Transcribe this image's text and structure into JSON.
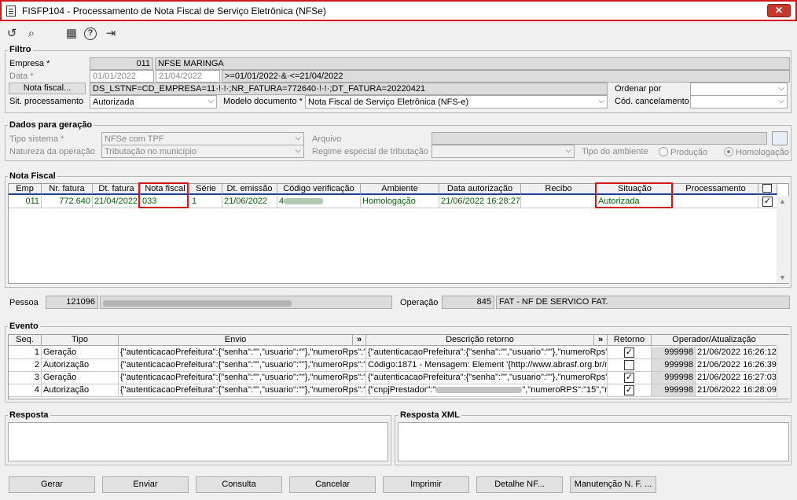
{
  "window": {
    "title": "FISFP104 - Processamento de Nota Fiscal de Serviço Eletrônica (NFSe)",
    "close": "✕"
  },
  "toolbar": {
    "undo": "↺",
    "search": "⌕",
    "calendar": "▦",
    "help": "?",
    "exit": "⇥"
  },
  "filtro": {
    "group": "Filtro",
    "empresa_label": "Empresa *",
    "empresa_code": "011",
    "empresa_name": "NFSE MARINGA",
    "data_label": "Data *",
    "data_from": "01/01/2022",
    "data_to": "21/04/2022",
    "data_expr": ">=01/01/2022·&·<=21/04/2022",
    "nota_btn": "Nota fiscal...",
    "nota_expr": "DS_LSTNF=CD_EMPRESA=11·!·!·;NR_FATURA=772640·!·!·;DT_FATURA=20220421",
    "ordenar_label": "Ordenar por",
    "ordenar_value": "",
    "sit_label": "Sit. processamento",
    "sit_value": "Autorizada",
    "modelo_label": "Modelo documento *",
    "modelo_value": "Nota Fiscal de Serviço Eletrônica (NFS-e)",
    "cod_label": "Cód. cancelamento",
    "cod_value": ""
  },
  "dados": {
    "group": "Dados para geração",
    "tipo_label": "Tipo sistema *",
    "tipo_value": "NFSe com TPF",
    "natureza_label": "Natureza da operação",
    "natureza_value": "Tributação no município",
    "arquivo_label": "Arquivo",
    "arquivo_value": "",
    "regime_label": "Regime especial de tributação",
    "regime_value": "",
    "ambiente_label": "Tipo do ambiente",
    "producao": "Produção",
    "homologacao": "Homologação"
  },
  "nota": {
    "group": "Nota Fiscal",
    "headers": [
      "Emp",
      "Nr. fatura",
      "Dt. fatura",
      "Nota fiscal",
      "Série",
      "Dt. emissão",
      "Código verificação",
      "Ambiente",
      "Data autorização",
      "Recibo",
      "Situação",
      "Processamento"
    ],
    "row": {
      "emp": "011",
      "nr": "772.640",
      "dt": "21/04/2022",
      "nf": "033",
      "serie": "1",
      "emissao": "21/06/2022",
      "codigo": "4",
      "ambiente": "Homologação",
      "data_aut": "21/06/2022 16:28:27",
      "recibo": "",
      "situacao": "Autorizada",
      "proc": ""
    },
    "checked": "✓"
  },
  "pessoa": {
    "label": "Pessoa",
    "code": "121096",
    "name": "",
    "op_label": "Operação",
    "op_code": "845",
    "op_name": "FAT - NF DE SERVICO FAT."
  },
  "evento": {
    "group": "Evento",
    "headers": [
      "Seq.",
      "Tipo",
      "Envio",
      "»",
      "Descrição retorno",
      "»",
      "Retorno",
      "Operador/Atualização"
    ],
    "rows": [
      {
        "seq": "1",
        "tipo": "Geração",
        "envio": "{\"autenticacaoPrefeitura\":{\"senha\":\"\",\"usuario\":\"\"},\"numeroRps\":\"",
        "retorno": "{\"autenticacaoPrefeitura\":{\"senha\":\"\",\"usuario\":\"\"},\"numeroRps\"",
        "check": "✓",
        "op": "999998",
        "dt": "21/06/2022 16:26:12"
      },
      {
        "seq": "2",
        "tipo": "Autorização",
        "envio": "{\"autenticacaoPrefeitura\":{\"senha\":\"\",\"usuario\":\"\"},\"numeroRps\":\"",
        "retorno": "Código:1871 - Mensagem: Element '{http://www.abrasf.org.br/n",
        "check": "",
        "op": "999998",
        "dt": "21/06/2022 16:26:39"
      },
      {
        "seq": "3",
        "tipo": "Geração",
        "envio": "{\"autenticacaoPrefeitura\":{\"senha\":\"\",\"usuario\":\"\"},\"numeroRps\":\"",
        "retorno": "{\"autenticacaoPrefeitura\":{\"senha\":\"\",\"usuario\":\"\"},\"numeroRps\"",
        "check": "✓",
        "op": "999998",
        "dt": "21/06/2022 16:27:03"
      },
      {
        "seq": "4",
        "tipo": "Autorização",
        "envio": "{\"autenticacaoPrefeitura\":{\"senha\":\"\",\"usuario\":\"\"},\"numeroRps\":\"",
        "retorno": "{\"cnpjPrestador\":\"",
        "retorno_tail": "\",\"numeroRPS\":\"15\",\"numero",
        "check": "✓",
        "op": "999998",
        "dt": "21/06/2022 16:28:09"
      }
    ]
  },
  "resposta": {
    "label": "Resposta",
    "xml_label": "Resposta XML"
  },
  "buttons": {
    "gerar": "Gerar",
    "enviar": "Enviar",
    "consulta": "Consulta",
    "cancelar": "Cancelar",
    "imprimir": "Imprimir",
    "detalhe": "Detalhe NF...",
    "manutencao": "Manutenção N. F. ..."
  }
}
